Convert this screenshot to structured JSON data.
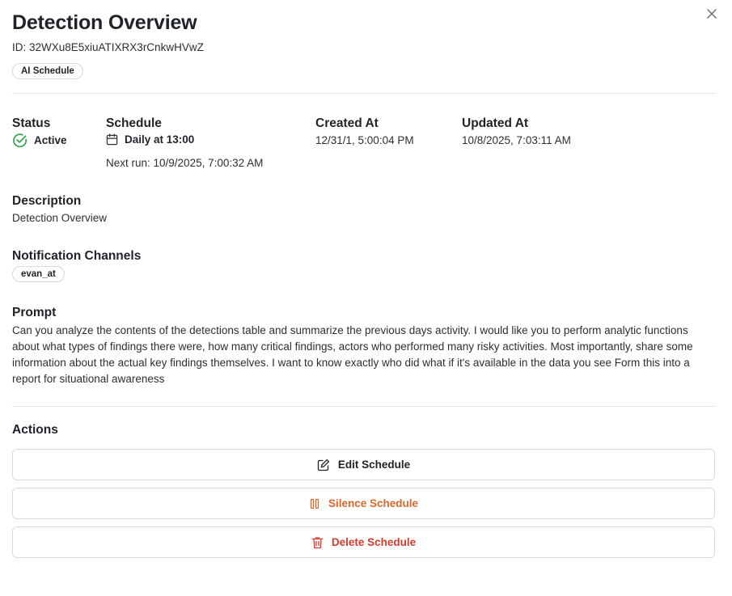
{
  "header": {
    "title": "Detection Overview",
    "id_line": "ID: 32WXu8E5xiuATIXRX3rCnkwHVwZ",
    "type_chip": "AI Schedule"
  },
  "details": {
    "status_label": "Status",
    "status_value": "Active",
    "schedule_label": "Schedule",
    "schedule_value": "Daily at 13:00",
    "next_run": "Next run: 10/9/2025, 7:00:32 AM",
    "created_label": "Created At",
    "created_value": "12/31/1, 5:00:04 PM",
    "updated_label": "Updated At",
    "updated_value": "10/8/2025, 7:03:11 AM"
  },
  "description": {
    "label": "Description",
    "value": "Detection Overview"
  },
  "notifications": {
    "label": "Notification Channels",
    "channels": [
      "evan_at"
    ]
  },
  "prompt": {
    "label": "Prompt",
    "text": "Can you analyze the contents of the detections table and summarize the previous days activity. I would like you to perform analytic functions about what types of findings there were, how many critical findings, actors who performed many risky activities. Most importantly, share some information about the actual key findings themselves. I want to know exactly who did what if it's available in the data you see Form this into a report for situational awareness"
  },
  "actions": {
    "label": "Actions",
    "edit": "Edit Schedule",
    "silence": "Silence Schedule",
    "delete": "Delete Schedule"
  },
  "colors": {
    "status_active": "#2ea44f",
    "silence": "#e0662a",
    "delete": "#d63b2f"
  },
  "icons": {
    "close": "close-icon",
    "status": "check-circle-icon",
    "schedule": "calendar-icon",
    "edit": "edit-icon",
    "silence": "pause-icon",
    "delete": "trash-icon"
  }
}
